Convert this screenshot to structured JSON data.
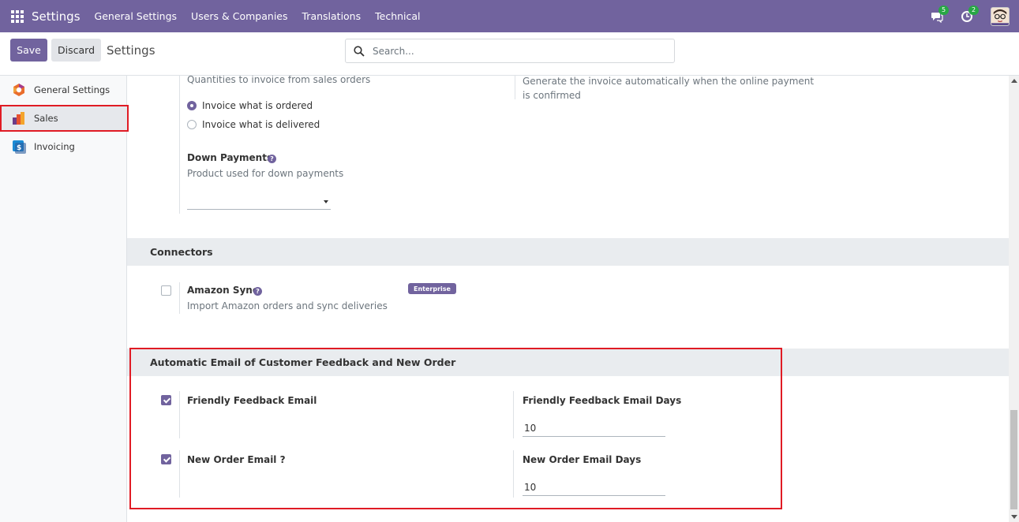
{
  "navbar": {
    "brand": "Settings",
    "menu": [
      "General Settings",
      "Users & Companies",
      "Translations",
      "Technical"
    ],
    "messages_count": "5",
    "activities_count": "2"
  },
  "control": {
    "save_label": "Save",
    "discard_label": "Discard",
    "title": "Settings",
    "search_placeholder": "Search..."
  },
  "sidebar": {
    "items": [
      {
        "label": "General Settings",
        "icon": "settings-app-icon"
      },
      {
        "label": "Sales",
        "icon": "sales-app-icon",
        "active": true
      },
      {
        "label": "Invoicing",
        "icon": "invoicing-app-icon"
      }
    ]
  },
  "invoicing_policy": {
    "description": "Quantities to invoice from sales orders",
    "options": [
      "Invoice what is ordered",
      "Invoice what is delivered"
    ],
    "selected": "Invoice what is ordered"
  },
  "automatic_invoice": {
    "description": "Generate the invoice automatically when the online payment is confirmed"
  },
  "down_payments": {
    "label": "Down Payments",
    "description": "Product used for down payments",
    "value": ""
  },
  "connectors": {
    "title": "Connectors",
    "amazon": {
      "label": "Amazon Sync",
      "description": "Import Amazon orders and sync deliveries",
      "badge": "Enterprise",
      "checked": false
    }
  },
  "feedback_section": {
    "title": "Automatic Email of Customer Feedback and New Order",
    "friendly_feedback": {
      "label": "Friendly Feedback Email",
      "checked": true
    },
    "friendly_feedback_days": {
      "label": "Friendly Feedback Email Days",
      "value": "10"
    },
    "new_order": {
      "label": "New Order Email ?",
      "checked": true
    },
    "new_order_days": {
      "label": "New Order Email Days",
      "value": "10"
    }
  },
  "colors": {
    "brand": "#71639e",
    "highlight": "#e01b24",
    "badge": "#28a745"
  }
}
